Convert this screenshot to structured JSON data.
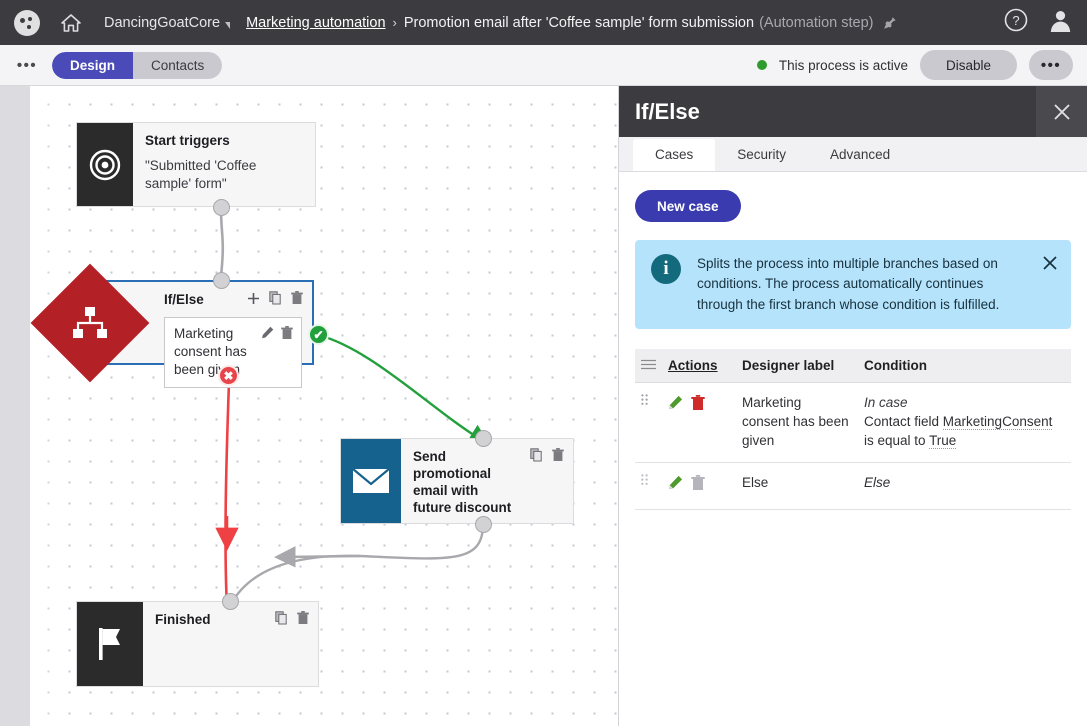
{
  "topbar": {
    "logo_icon": "kentico-dots-icon",
    "home_icon": "home-icon",
    "site": "DancingGoatCore",
    "section_link": "Marketing automation",
    "separator": "›",
    "current": "Promotion email after 'Coffee sample' form submission",
    "current_suffix": "(Automation step)",
    "pin_icon": "pin-icon",
    "help_icon": "help-icon",
    "user_icon": "user-avatar-icon"
  },
  "subbar": {
    "more_icon": "ellipsis-icon",
    "tabs": [
      {
        "label": "Design",
        "active": true
      },
      {
        "label": "Contacts",
        "active": false
      }
    ],
    "status_text": "This process is active",
    "status_color": "#2e9b2e",
    "disable_label": "Disable",
    "more_label": "•••"
  },
  "canvas": {
    "nodes": [
      {
        "id": "start",
        "icon": "target-bullseye-icon",
        "title": "Start triggers",
        "subtitle": "\"Submitted 'Coffee sample' form\""
      },
      {
        "id": "ifelse",
        "icon": "sitemap-icon",
        "title": "If/Else",
        "case_text": "Marketing consent has been given",
        "tools": [
          "plus-icon",
          "copy-icon",
          "trash-icon"
        ],
        "case_tools": [
          "pencil-icon",
          "trash-icon"
        ],
        "selected": true
      },
      {
        "id": "email",
        "icon": "envelope-icon",
        "title": "Send promotional email with future discount",
        "tools": [
          "copy-icon",
          "trash-icon"
        ]
      },
      {
        "id": "finished",
        "icon": "flag-icon",
        "title": "Finished",
        "tools": [
          "copy-icon",
          "trash-icon"
        ]
      }
    ],
    "badges": {
      "true_badge": "✔",
      "false_badge": "✕"
    },
    "wire_colors": {
      "true": "#22a03c",
      "false": "#ef4044",
      "neutral": "#a9a9ad"
    }
  },
  "panel": {
    "title": "If/Else",
    "close_icon": "close-icon",
    "tabs": [
      {
        "label": "Cases",
        "active": true
      },
      {
        "label": "Security",
        "active": false
      },
      {
        "label": "Advanced",
        "active": false
      }
    ],
    "new_case_label": "New case",
    "info": {
      "icon": "info-icon",
      "text": "Splits the process into multiple branches based on conditions. The process automatically continues through the first branch whose condition is fulfilled.",
      "close_icon": "close-icon",
      "background": "#b5e3fb"
    },
    "table": {
      "headers": {
        "handle": "☰",
        "actions": "Actions",
        "designer_label": "Designer label",
        "condition": "Condition"
      },
      "rows": [
        {
          "handle_icon": "drag-handle-icon",
          "edit_icon": "pencil-icon",
          "delete_icon": "trash-icon",
          "delete_enabled": true,
          "designer_label": "Marketing consent has been given",
          "condition_prefix": "In case",
          "condition_line1_a": "Contact field ",
          "condition_macro1": "MarketingConsent",
          "condition_line1_b": " is equal to ",
          "condition_macro2": "True"
        },
        {
          "handle_icon": "drag-handle-icon",
          "edit_icon": "pencil-icon",
          "delete_icon": "trash-icon",
          "delete_enabled": false,
          "designer_label": "Else",
          "condition_prefix": "Else"
        }
      ]
    }
  }
}
